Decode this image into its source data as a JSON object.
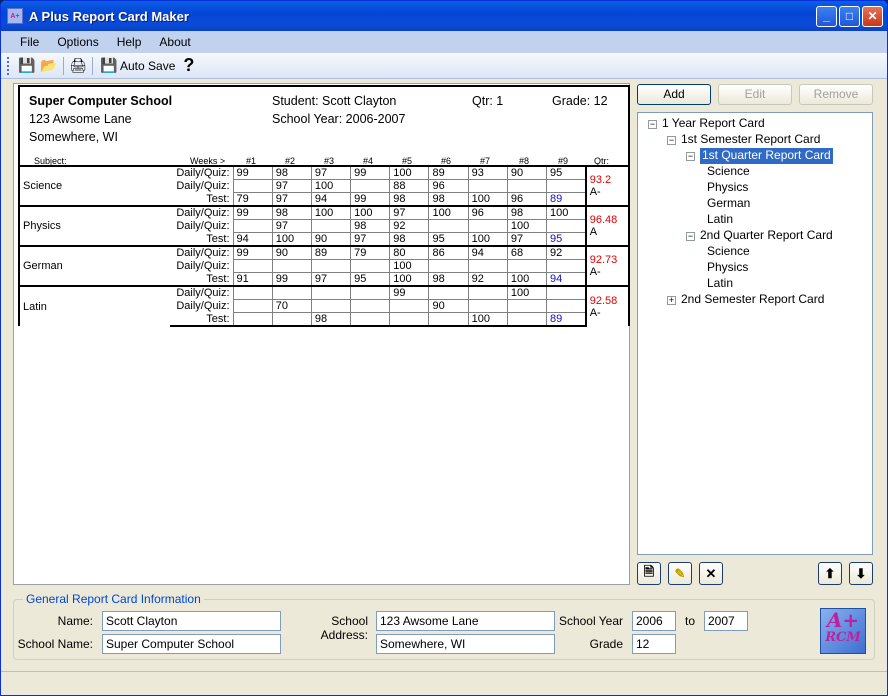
{
  "window": {
    "title": "A Plus Report Card Maker",
    "app_icon": "A+ RCM",
    "min_label": "_",
    "max_label": "□",
    "close_label": "✕"
  },
  "menu": [
    {
      "label": "File",
      "key": "F"
    },
    {
      "label": "Options",
      "key": "O"
    },
    {
      "label": "Help",
      "key": "H"
    },
    {
      "label": "About",
      "key": "A"
    }
  ],
  "toolbar": {
    "save_icon": "💾",
    "open_icon": "📂",
    "print_icon": "🖨",
    "autosave_icon": "💾",
    "autosave_label": "Auto Save",
    "help_label": "?"
  },
  "card": {
    "school_name": "Super Computer School",
    "address1": "123 Awsome Lane",
    "address2": "Somewhere, WI",
    "student": "Student: Scott Clayton",
    "school_year": "School Year: 2006-2007",
    "qtr": "Qtr: 1",
    "grade": "Grade: 12",
    "col_subject": "Subject:",
    "col_weeks": "Weeks >",
    "weeks": [
      "#1",
      "#2",
      "#3",
      "#4",
      "#5",
      "#6",
      "#7",
      "#8",
      "#9"
    ],
    "col_qtr": "Qtr:",
    "row_labels": [
      "Daily/Quiz:",
      "Daily/Quiz:",
      "Test:"
    ],
    "subjects": [
      {
        "name": "Science",
        "avg": "93.2",
        "letter": "A-",
        "rows": [
          [
            "99",
            "98",
            "97",
            "99",
            "100",
            "89",
            "93",
            "90",
            "95"
          ],
          [
            "",
            "97",
            "100",
            "",
            "88",
            "96",
            "",
            "",
            ""
          ],
          [
            "79",
            "97",
            "94",
            "99",
            "98",
            "98",
            "100",
            "96",
            "89"
          ]
        ]
      },
      {
        "name": "Physics",
        "avg": "96.48",
        "letter": "A",
        "rows": [
          [
            "99",
            "98",
            "100",
            "100",
            "97",
            "100",
            "96",
            "98",
            "100"
          ],
          [
            "",
            "97",
            "",
            "98",
            "92",
            "",
            "",
            "100",
            ""
          ],
          [
            "94",
            "100",
            "90",
            "97",
            "98",
            "95",
            "100",
            "97",
            "95"
          ]
        ]
      },
      {
        "name": "German",
        "avg": "92.73",
        "letter": "A-",
        "rows": [
          [
            "99",
            "90",
            "89",
            "79",
            "80",
            "86",
            "94",
            "68",
            "92"
          ],
          [
            "",
            "",
            "",
            "",
            "100",
            "",
            "",
            "",
            ""
          ],
          [
            "91",
            "99",
            "97",
            "95",
            "100",
            "98",
            "92",
            "100",
            "94"
          ]
        ]
      },
      {
        "name": "Latin",
        "avg": "92.58",
        "letter": "A-",
        "rows": [
          [
            "",
            "",
            "",
            "",
            "99",
            "",
            "",
            "100",
            ""
          ],
          [
            "",
            "70",
            "",
            "",
            "",
            "90",
            "",
            "",
            ""
          ],
          [
            "",
            "",
            "98",
            "",
            "",
            "",
            "100",
            "",
            "89"
          ]
        ]
      }
    ]
  },
  "right_panel": {
    "add_label": "Add",
    "edit_label": "Edit",
    "remove_label": "Remove",
    "tree": [
      {
        "label": "1 Year Report Card",
        "expander": "−"
      },
      {
        "label": "1st Semester Report Card",
        "expander": "−"
      },
      {
        "label": "1st Quarter Report Card",
        "expander": "−",
        "selected": true
      },
      {
        "label": "Science"
      },
      {
        "label": "Physics"
      },
      {
        "label": "German"
      },
      {
        "label": "Latin"
      },
      {
        "label": "2nd Quarter Report Card",
        "expander": "−"
      },
      {
        "label": "Science"
      },
      {
        "label": "Physics"
      },
      {
        "label": "Latin"
      },
      {
        "label": "2nd Semester Report Card",
        "expander": "+"
      }
    ],
    "icons": {
      "new": "🗎",
      "edit": "✎",
      "delete": "✕",
      "up": "⬆",
      "down": "⬇"
    }
  },
  "general": {
    "title": "General Report Card Information",
    "name_label": "Name:",
    "name_value": "Scott Clayton",
    "school_name_label": "School Name:",
    "school_name_value": "Super Computer School",
    "address_label": "School Address:",
    "address1_value": "123 Awsome Lane",
    "address2_value": "Somewhere, WI",
    "year_label": "School Year",
    "year_from": "2006",
    "to_label": "to",
    "year_to": "2007",
    "grade_label": "Grade",
    "grade_value": "12",
    "logo_top": "A+",
    "logo_bottom": "RCM"
  }
}
